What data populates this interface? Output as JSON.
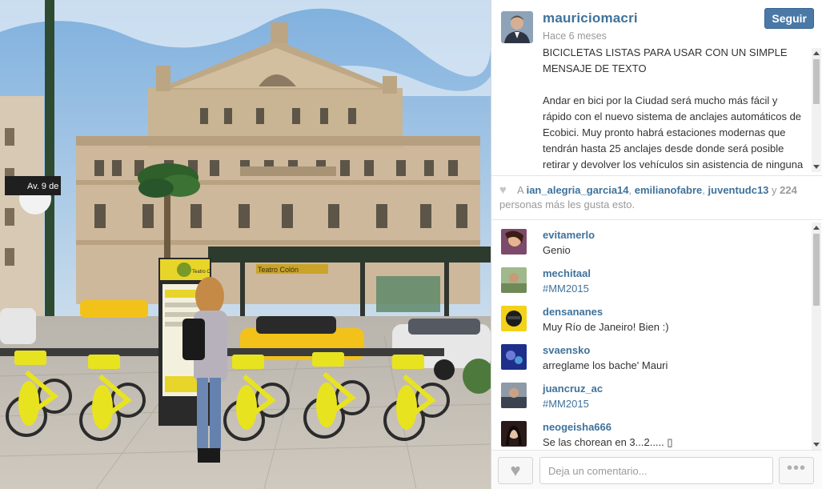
{
  "post": {
    "username": "mauriciomacri",
    "follow_label": "Seguir",
    "time_ago": "Hace 6 meses",
    "caption_title": "BICICLETAS LISTAS PARA USAR CON UN SIMPLE MENSAJE DE TEXTO",
    "caption_body": "Andar en bici por la Ciudad será mucho más fácil y rápido con el nuevo sistema de anclajes automáticos de Ecobici. Muy pronto habrá estaciones modernas que tendrán hasta 25 anclajes desde donde será posible retirar y devolver los vehículos sin asistencia de ninguna"
  },
  "likes": {
    "prefix": "A",
    "users": [
      "ian_alegria_garcia14",
      "emilianofabre",
      "juventudc13"
    ],
    "separator_comma": ",",
    "conjunction": "y",
    "count": "224",
    "suffix": "personas más les gusta esto."
  },
  "comments": [
    {
      "user": "evitamerlo",
      "text": "Genio",
      "is_tag": false
    },
    {
      "user": "mechitaal",
      "text": "#MM2015",
      "is_tag": true
    },
    {
      "user": "densananes",
      "text": "Muy Río de Janeiro! Bien :)",
      "is_tag": false
    },
    {
      "user": "svaensko",
      "text": "arreglame los bache' Mauri",
      "is_tag": false
    },
    {
      "user": "juancruz_ac",
      "text": "#MM2015",
      "is_tag": true
    },
    {
      "user": "neogeisha666",
      "text": "Se las chorean en 3...2..... ▯",
      "is_tag": false
    }
  ],
  "comment_box": {
    "placeholder": "Deja un comentario..."
  },
  "photo": {
    "street_sign": "Av. 9 de",
    "station_sign": "Teatro C",
    "building_sign": "Teatro Colón"
  },
  "icons": {
    "like": "heart-icon",
    "more": "ellipsis-icon"
  },
  "colors": {
    "link": "#3f729b",
    "follow_button": "#4a79a7",
    "bike_yellow": "#e8e31f"
  }
}
